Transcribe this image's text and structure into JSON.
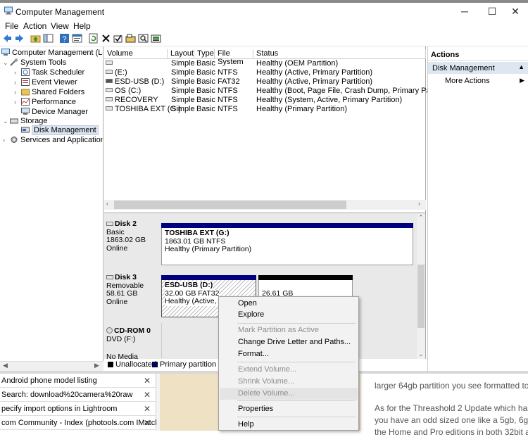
{
  "window": {
    "title": "Computer Management",
    "controls": {
      "minimize": "─",
      "maximize": "☐",
      "close": "✕"
    }
  },
  "menu": [
    "File",
    "Action",
    "View",
    "Help"
  ],
  "toolbar_icons": [
    "back-icon",
    "forward-icon",
    "up-folder-icon",
    "show-hide-tree-icon",
    "help-icon",
    "properties-icon",
    "refresh-icon",
    "delete-icon",
    "check-icon",
    "open-icon",
    "search-icon",
    "disk-icon"
  ],
  "tree": {
    "root": "Computer Management (Local",
    "system_tools": "System Tools",
    "task_scheduler": "Task Scheduler",
    "event_viewer": "Event Viewer",
    "shared_folders": "Shared Folders",
    "performance": "Performance",
    "device_manager": "Device Manager",
    "storage": "Storage",
    "disk_management": "Disk Management",
    "services": "Services and Applications"
  },
  "volumes": {
    "columns": [
      "Volume",
      "Layout",
      "Type",
      "File System",
      "Status"
    ],
    "rows": [
      {
        "volume": "",
        "layout": "Simple",
        "type": "Basic",
        "fs": "",
        "status": "Healthy (OEM Partition)"
      },
      {
        "volume": "(E:)",
        "layout": "Simple",
        "type": "Basic",
        "fs": "NTFS",
        "status": "Healthy (Active, Primary Partition)"
      },
      {
        "volume": "ESD-USB (D:)",
        "layout": "Simple",
        "type": "Basic",
        "fs": "FAT32",
        "status": "Healthy (Active, Primary Partition)"
      },
      {
        "volume": "OS (C:)",
        "layout": "Simple",
        "type": "Basic",
        "fs": "NTFS",
        "status": "Healthy (Boot, Page File, Crash Dump, Primary Partition)"
      },
      {
        "volume": "RECOVERY",
        "layout": "Simple",
        "type": "Basic",
        "fs": "NTFS",
        "status": "Healthy (System, Active, Primary Partition)"
      },
      {
        "volume": "TOSHIBA EXT (G:)",
        "layout": "Simple",
        "type": "Basic",
        "fs": "NTFS",
        "status": "Healthy (Primary Partition)"
      }
    ]
  },
  "disks": {
    "disk2": {
      "name": "Disk 2",
      "type": "Basic",
      "size": "1863.02 GB",
      "state": "Online",
      "part_name": "TOSHIBA EXT  (G:)",
      "part_size": "1863.01 GB NTFS",
      "part_status": "Healthy (Primary Partition)"
    },
    "disk3": {
      "name": "Disk 3",
      "type": "Removable",
      "size": "58.61 GB",
      "state": "Online",
      "p1_name": "ESD-USB  (D:)",
      "p1_size": "32.00 GB FAT32",
      "p1_status": "Healthy (Active, Pri",
      "p2_size": "26.61 GB"
    },
    "cdrom": {
      "name": "CD-ROM 0",
      "type": "DVD (F:)",
      "state": "No Media"
    }
  },
  "legend": {
    "unallocated": "Unallocated",
    "primary": "Primary partition"
  },
  "colors": {
    "primary": "#00007f",
    "unallocated": "#000000",
    "selection": "#dde6f1"
  },
  "actions": {
    "header": "Actions",
    "section": "Disk Management",
    "more": "More Actions"
  },
  "context_menu": {
    "open": "Open",
    "explore": "Explore",
    "mark_active": "Mark Partition as Active",
    "change_letter": "Change Drive Letter and Paths...",
    "format": "Format...",
    "extend": "Extend Volume...",
    "shrink": "Shrink Volume...",
    "delete": "Delete Volume...",
    "properties": "Properties",
    "help": "Help"
  },
  "background": {
    "rows": [
      "Android phone model listing",
      "Search: download%20camera%20raw",
      "pecify import options in Lightroom",
      "com Community - Index (photools.com IMatch..."
    ],
    "text1": "larger 64gb partition you see formatted to",
    "text2": "As for the Threashold 2 Update which has b",
    "text3": "you have an odd sized one like a 5gb, 6gb,",
    "text4": "the Home and Pro editions in both 32bit a"
  }
}
